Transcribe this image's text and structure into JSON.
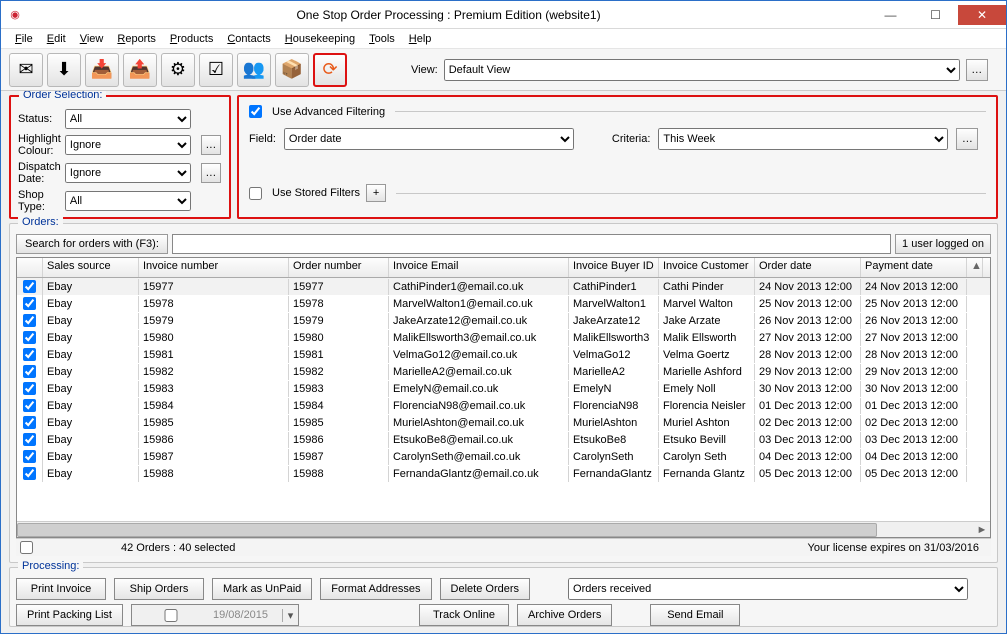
{
  "window": {
    "title": "One Stop Order Processing : Premium Edition (website1)"
  },
  "menu": [
    "File",
    "Edit",
    "View",
    "Reports",
    "Products",
    "Contacts",
    "Housekeeping",
    "Tools",
    "Help"
  ],
  "toolbar_icons": [
    "new-order",
    "import",
    "export-down",
    "export-up",
    "settings",
    "checklist",
    "users",
    "packages",
    "refresh"
  ],
  "view": {
    "label": "View:",
    "value": "Default View"
  },
  "order_selection": {
    "legend": "Order Selection:",
    "rows": [
      {
        "label": "Status:",
        "value": "All",
        "dots": false
      },
      {
        "label": "Highlight Colour:",
        "value": "Ignore",
        "dots": true
      },
      {
        "label": "Dispatch Date:",
        "value": "Ignore",
        "dots": true
      },
      {
        "label": "Shop Type:",
        "value": "All",
        "dots": false
      }
    ]
  },
  "filtering": {
    "use_advanced_label": "Use Advanced Filtering",
    "use_advanced_checked": true,
    "field_label": "Field:",
    "field_value": "Order date",
    "criteria_label": "Criteria:",
    "criteria_value": "This Week",
    "use_stored_label": "Use Stored Filters",
    "use_stored_checked": false
  },
  "orders": {
    "legend": "Orders:",
    "search_label": "Search for orders with (F3):",
    "search_value": "",
    "logged_in": "1 user logged on",
    "columns": [
      "",
      "Sales source",
      "Invoice number",
      "Order number",
      "Invoice Email",
      "Invoice Buyer ID",
      "Invoice Customer",
      "Order date",
      "Payment date"
    ],
    "rows": [
      {
        "chk": true,
        "src": "Ebay",
        "inv": "15977",
        "ord": "15977",
        "email": "CathiPinder1@email.co.uk",
        "buyer": "CathiPinder1",
        "cust": "Cathi Pinder",
        "odate": "24 Nov 2013 12:00",
        "pdate": "24 Nov 2013 12:00"
      },
      {
        "chk": true,
        "src": "Ebay",
        "inv": "15978",
        "ord": "15978",
        "email": "MarvelWalton1@email.co.uk",
        "buyer": "MarvelWalton1",
        "cust": "Marvel Walton",
        "odate": "25 Nov 2013 12:00",
        "pdate": "25 Nov 2013 12:00"
      },
      {
        "chk": true,
        "src": "Ebay",
        "inv": "15979",
        "ord": "15979",
        "email": "JakeArzate12@email.co.uk",
        "buyer": "JakeArzate12",
        "cust": "Jake Arzate",
        "odate": "26 Nov 2013 12:00",
        "pdate": "26 Nov 2013 12:00"
      },
      {
        "chk": true,
        "src": "Ebay",
        "inv": "15980",
        "ord": "15980",
        "email": "MalikEllsworth3@email.co.uk",
        "buyer": "MalikEllsworth3",
        "cust": "Malik Ellsworth",
        "odate": "27 Nov 2013 12:00",
        "pdate": "27 Nov 2013 12:00"
      },
      {
        "chk": true,
        "src": "Ebay",
        "inv": "15981",
        "ord": "15981",
        "email": "VelmaGo12@email.co.uk",
        "buyer": "VelmaGo12",
        "cust": "Velma Goertz",
        "odate": "28 Nov 2013 12:00",
        "pdate": "28 Nov 2013 12:00"
      },
      {
        "chk": true,
        "src": "Ebay",
        "inv": "15982",
        "ord": "15982",
        "email": "MarielleA2@email.co.uk",
        "buyer": "MarielleA2",
        "cust": "Marielle Ashford",
        "odate": "29 Nov 2013 12:00",
        "pdate": "29 Nov 2013 12:00"
      },
      {
        "chk": true,
        "src": "Ebay",
        "inv": "15983",
        "ord": "15983",
        "email": "EmelyN@email.co.uk",
        "buyer": "EmelyN",
        "cust": "Emely Noll",
        "odate": "30 Nov 2013 12:00",
        "pdate": "30 Nov 2013 12:00"
      },
      {
        "chk": true,
        "src": "Ebay",
        "inv": "15984",
        "ord": "15984",
        "email": "FlorenciaN98@email.co.uk",
        "buyer": "FlorenciaN98",
        "cust": "Florencia Neisler",
        "odate": "01 Dec 2013 12:00",
        "pdate": "01 Dec 2013 12:00"
      },
      {
        "chk": true,
        "src": "Ebay",
        "inv": "15985",
        "ord": "15985",
        "email": "MurielAshton@email.co.uk",
        "buyer": "MurielAshton",
        "cust": "Muriel Ashton",
        "odate": "02 Dec 2013 12:00",
        "pdate": "02 Dec 2013 12:00"
      },
      {
        "chk": true,
        "src": "Ebay",
        "inv": "15986",
        "ord": "15986",
        "email": "EtsukoBe8@email.co.uk",
        "buyer": "EtsukoBe8",
        "cust": "Etsuko Bevill",
        "odate": "03 Dec 2013 12:00",
        "pdate": "03 Dec 2013 12:00"
      },
      {
        "chk": true,
        "src": "Ebay",
        "inv": "15987",
        "ord": "15987",
        "email": "CarolynSeth@email.co.uk",
        "buyer": "CarolynSeth",
        "cust": "Carolyn Seth",
        "odate": "04 Dec 2013 12:00",
        "pdate": "04 Dec 2013 12:00"
      },
      {
        "chk": true,
        "src": "Ebay",
        "inv": "15988",
        "ord": "15988",
        "email": "FernandaGlantz@email.co.uk",
        "buyer": "FernandaGlantz",
        "cust": "Fernanda Glantz",
        "odate": "05 Dec 2013 12:00",
        "pdate": "05 Dec 2013 12:00"
      }
    ],
    "footer_count": "42 Orders  : 40 selected",
    "license": "Your license expires on 31/03/2016"
  },
  "processing": {
    "legend": "Processing:",
    "buttons_row1": [
      "Print Invoice",
      "Ship Orders",
      "Mark as UnPaid",
      "Format Addresses",
      "Delete Orders"
    ],
    "buttons_row2": [
      "Print Packing List",
      "",
      "",
      "Track Online",
      "Archive Orders"
    ],
    "date": "19/08/2015",
    "status_value": "Orders received",
    "send_email": "Send Email"
  }
}
